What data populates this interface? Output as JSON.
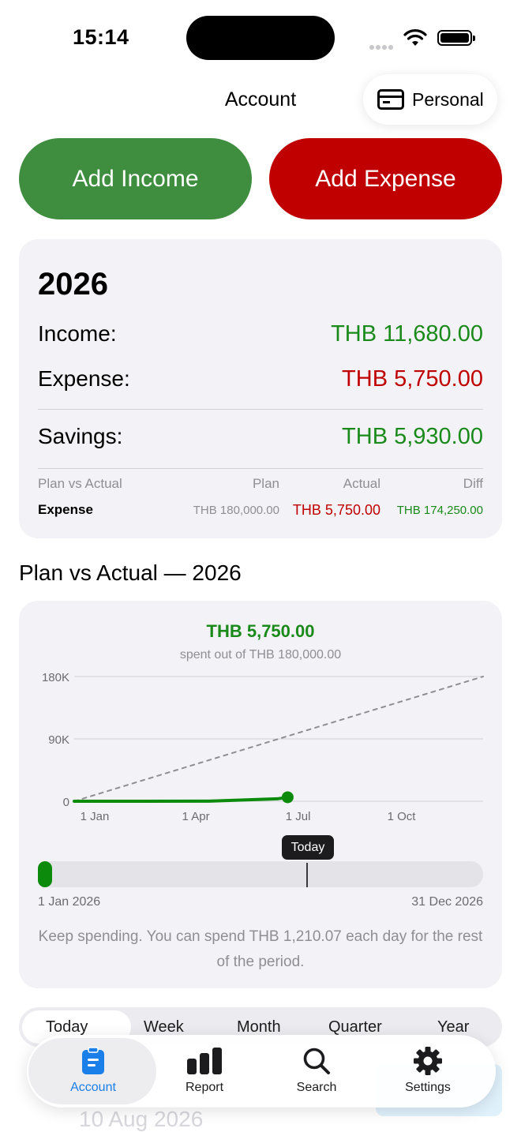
{
  "status_bar": {
    "time": "15:14"
  },
  "nav": {
    "title": "Account",
    "account_label": "Personal"
  },
  "actions": {
    "add_income": "Add Income",
    "add_expense": "Add Expense"
  },
  "summary": {
    "year": "2026",
    "income_label": "Income:",
    "income_value": "THB 11,680.00",
    "expense_label": "Expense:",
    "expense_value": "THB 5,750.00",
    "savings_label": "Savings:",
    "savings_value": "THB 5,930.00",
    "plan_vs_actual": {
      "headers": [
        "Plan vs Actual",
        "Plan",
        "Actual",
        "Diff"
      ],
      "row": {
        "label": "Expense",
        "plan": "THB 180,000.00",
        "actual": "THB 5,750.00",
        "diff": "THB 174,250.00"
      }
    }
  },
  "section_title": "Plan vs Actual — 2026",
  "chart_data": {
    "type": "line",
    "title": "THB 5,750.00",
    "subtitle": "spent out of THB 180,000.00",
    "x_tick_labels": [
      "1 Jan",
      "1 Apr",
      "1 Jul",
      "1 Oct"
    ],
    "y_tick_labels": [
      "180K",
      "90K",
      "0"
    ],
    "ylim": [
      0,
      180000
    ],
    "xlim": [
      "2026-01-01",
      "2026-12-31"
    ],
    "grid": true,
    "series": [
      {
        "style": "dashed",
        "color": "#8e8e93",
        "x": [
          "2026-01-01",
          "2026-12-31"
        ],
        "y": [
          0,
          180000
        ]
      },
      {
        "style": "solid",
        "color": "#0c8a0c",
        "x": [
          "2026-01-01",
          "2026-03-01",
          "2026-05-01",
          "2026-06-01",
          "2026-07-01",
          "2026-07-10"
        ],
        "y": [
          0,
          0,
          200,
          1800,
          3500,
          5750
        ]
      }
    ]
  },
  "period_progress": {
    "today_label": "Today",
    "start_label": "1 Jan 2026",
    "end_label": "31 Dec 2026",
    "spent_fraction": 0.032,
    "elapsed_fraction": 0.605,
    "message": "Keep spending. You can spend THB 1,210.07 each day for the rest of the period."
  },
  "period_tabs": [
    "Today",
    "Week",
    "Month",
    "Quarter",
    "Year"
  ],
  "background_row": {
    "date": "10 Aug 2026"
  },
  "tab_bar": [
    {
      "label": "Account",
      "icon": "account-clipboard-icon",
      "active": true
    },
    {
      "label": "Report",
      "icon": "bar-chart-icon",
      "active": false
    },
    {
      "label": "Search",
      "icon": "magnifier-icon",
      "active": false
    },
    {
      "label": "Settings",
      "icon": "gear-icon",
      "active": false
    }
  ],
  "colors": {
    "income": "#3f8d3f",
    "expense": "#c00000",
    "positive": "#1a8a1a",
    "accent": "#1a7fe8"
  }
}
